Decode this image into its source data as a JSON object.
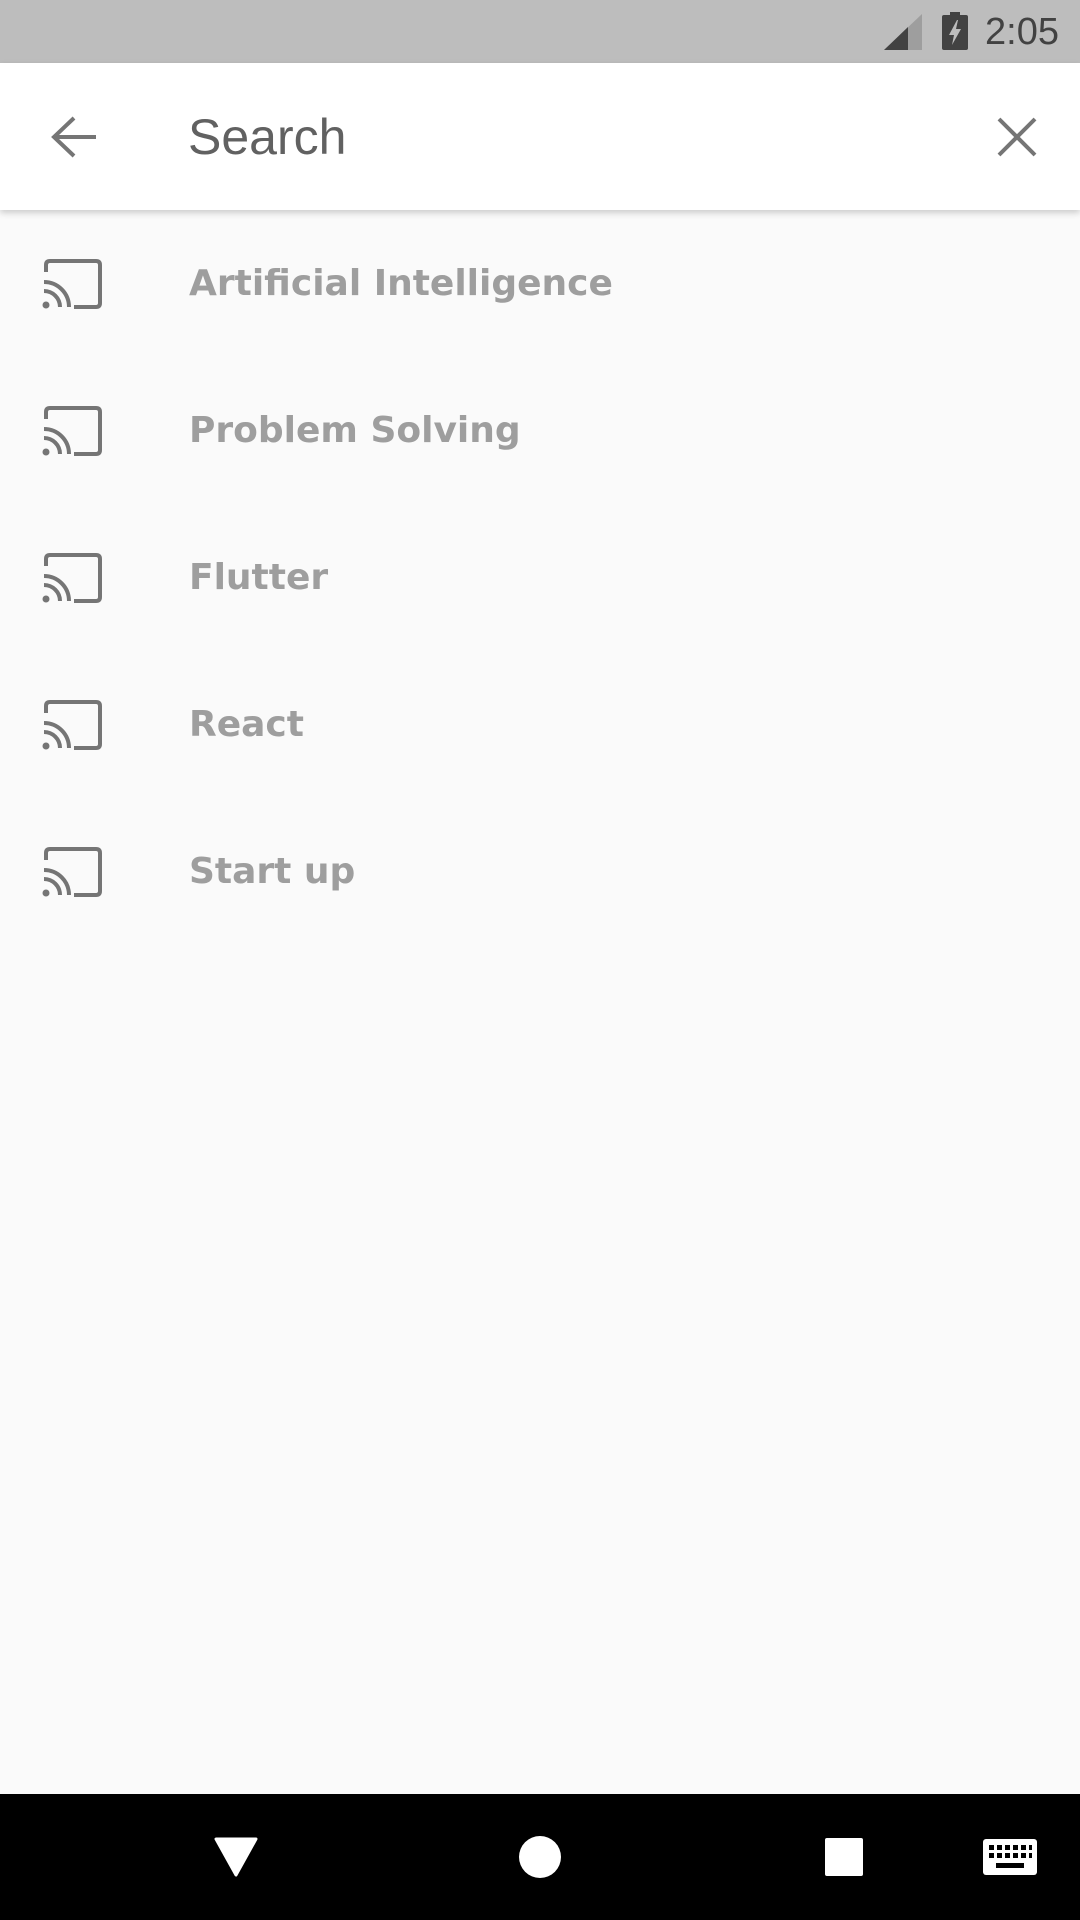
{
  "status_bar": {
    "time": "2:05",
    "icons": [
      "signal-icon",
      "battery-charging-icon"
    ],
    "background_color": "#bdbdbd"
  },
  "search_bar": {
    "placeholder": "Search",
    "value": "",
    "back_icon": "arrow-back-icon",
    "clear_icon": "close-icon"
  },
  "suggestions": {
    "icon": "cast-icon",
    "items": [
      {
        "label": "Artificial Intelligence"
      },
      {
        "label": "Problem Solving"
      },
      {
        "label": "Flutter"
      },
      {
        "label": "React"
      },
      {
        "label": "Start up"
      }
    ]
  },
  "nav_bar": {
    "buttons": [
      "back-triangle-icon",
      "home-circle-icon",
      "recents-square-icon",
      "keyboard-icon"
    ]
  },
  "colors": {
    "background": "#fafafa",
    "text_muted": "#9e9e9e",
    "icon_gray": "#757575",
    "search_text": "#616161"
  }
}
